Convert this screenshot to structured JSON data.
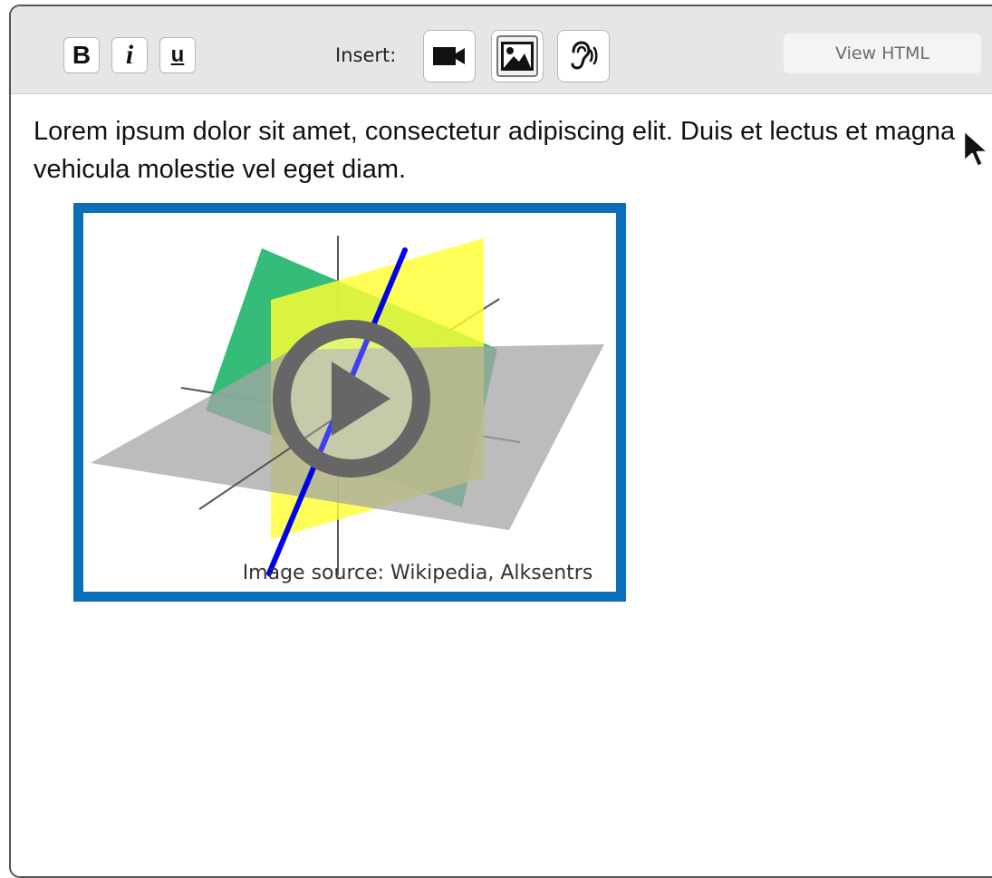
{
  "toolbar": {
    "bold_label": "B",
    "italic_label": "i",
    "underline_label": "u",
    "insert_label": "Insert:",
    "insert_buttons": [
      {
        "icon": "video-camera-icon"
      },
      {
        "icon": "image-icon"
      },
      {
        "icon": "ear-icon"
      }
    ],
    "view_html_label": "View HTML"
  },
  "content": {
    "paragraph": "Lorem ipsum dolor sit amet, consectetur adipiscing elit. Duis et lectus et magna vehicula molestie vel eget diam.",
    "media": {
      "caption": "Image source: Wikipedia, Alksentrs",
      "play_icon": "play-icon"
    }
  },
  "colors": {
    "toolbar_bg": "#e6e6e6",
    "media_border": "#0a6fb8",
    "plane_green": "#1fb56a",
    "plane_yellow": "#ffff33",
    "plane_gray": "#a6a6a6",
    "line_blue": "#0000ee",
    "play_gray": "#666666"
  }
}
